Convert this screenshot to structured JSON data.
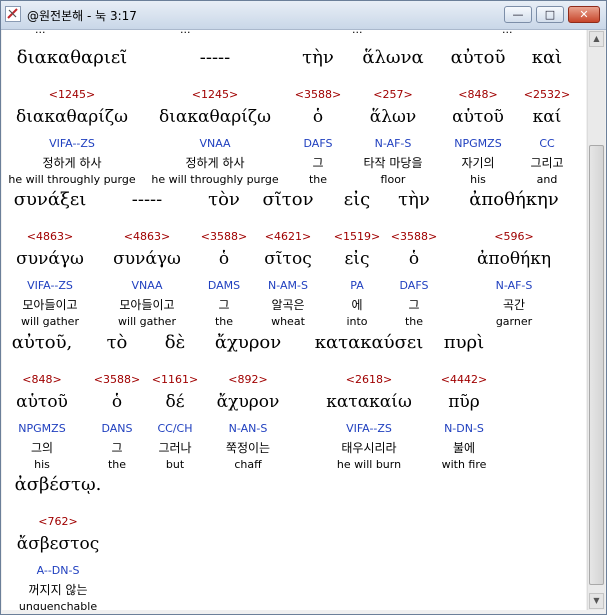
{
  "window": {
    "title": "@원전본해 - 눅 3:17"
  },
  "colors": {
    "strong": "#a00000",
    "parsing": "#1f3fbf",
    "text": "#000000"
  },
  "clipped_top": [
    "...",
    "...",
    "...",
    "..."
  ],
  "rows": [
    {
      "words": [
        {
          "greek": "διακαθαριεῖ",
          "strong": "<1245>",
          "lemma": "διακαθαρίζω",
          "parse": "VIFA--ZS",
          "korean": "정하게 하사",
          "english": "he will throughly purge"
        },
        {
          "greek": "-----",
          "strong": "<1245>",
          "lemma": "διακαθαρίζω",
          "parse": "VNAA",
          "korean": "정하게 하사",
          "english": "he will throughly purge"
        },
        {
          "greek": "τὴν",
          "strong": "<3588>",
          "lemma": "ὁ",
          "parse": "DAFS",
          "korean": "그",
          "english": "the"
        },
        {
          "greek": "ἅλωνα",
          "strong": "<257>",
          "lemma": "ἅλων",
          "parse": "N-AF-S",
          "korean": "타작 마당을",
          "english": "floor"
        },
        {
          "greek": "αὐτοῦ",
          "strong": "<848>",
          "lemma": "αὑτοῦ",
          "parse": "NPGMZS",
          "korean": "자기의",
          "english": "his"
        },
        {
          "greek": "καὶ",
          "strong": "<2532>",
          "lemma": "καί",
          "parse": "CC",
          "korean": "그리고",
          "english": "and"
        }
      ]
    },
    {
      "words": [
        {
          "greek": "συνάξει",
          "strong": "<4863>",
          "lemma": "συνάγω",
          "parse": "VIFA--ZS",
          "korean": "모아들이고",
          "english": "will gather"
        },
        {
          "greek": "-----",
          "strong": "<4863>",
          "lemma": "συνάγω",
          "parse": "VNAA",
          "korean": "모아들이고",
          "english": "will gather"
        },
        {
          "greek": "τὸν",
          "strong": "<3588>",
          "lemma": "ὁ",
          "parse": "DAMS",
          "korean": "그",
          "english": "the"
        },
        {
          "greek": "σῖτον",
          "strong": "<4621>",
          "lemma": "σῖτος",
          "parse": "N-AM-S",
          "korean": "알곡은",
          "english": "wheat"
        },
        {
          "greek": "εἰς",
          "strong": "<1519>",
          "lemma": "εἰς",
          "parse": "PA",
          "korean": "에",
          "english": "into"
        },
        {
          "greek": "τὴν",
          "strong": "<3588>",
          "lemma": "ὁ",
          "parse": "DAFS",
          "korean": "그",
          "english": "the"
        },
        {
          "greek": "ἀποθήκην",
          "strong": "<596>",
          "lemma": "ἀποθήκη",
          "parse": "N-AF-S",
          "korean": "곡간",
          "english": "garner"
        }
      ]
    },
    {
      "words": [
        {
          "greek": "αὐτοῦ,",
          "strong": "<848>",
          "lemma": "αὑτοῦ",
          "parse": "NPGMZS",
          "korean": "그의",
          "english": "his"
        },
        {
          "greek": "τὸ",
          "strong": "<3588>",
          "lemma": "ὁ",
          "parse": "DANS",
          "korean": "그",
          "english": "the"
        },
        {
          "greek": "δὲ",
          "strong": "<1161>",
          "lemma": "δέ",
          "parse": "CC/CH",
          "korean": "그러나",
          "english": "but"
        },
        {
          "greek": "ἄχυρον",
          "strong": "<892>",
          "lemma": "ἄχυρον",
          "parse": "N-AN-S",
          "korean": "쭉정이는",
          "english": "chaff"
        },
        {
          "greek": "κατακαύσει",
          "strong": "<2618>",
          "lemma": "κατακαίω",
          "parse": "VIFA--ZS",
          "korean": "태우시리라",
          "english": "he will burn"
        },
        {
          "greek": "πυρὶ",
          "strong": "<4442>",
          "lemma": "πῦρ",
          "parse": "N-DN-S",
          "korean": "불에",
          "english": "with fire"
        }
      ]
    },
    {
      "words": [
        {
          "greek": "ἀσβέστῳ.",
          "strong": "<762>",
          "lemma": "ἄσβεστος",
          "parse": "A--DN-S",
          "korean": "꺼지지 않는",
          "english": "unquenchable"
        }
      ]
    }
  ]
}
